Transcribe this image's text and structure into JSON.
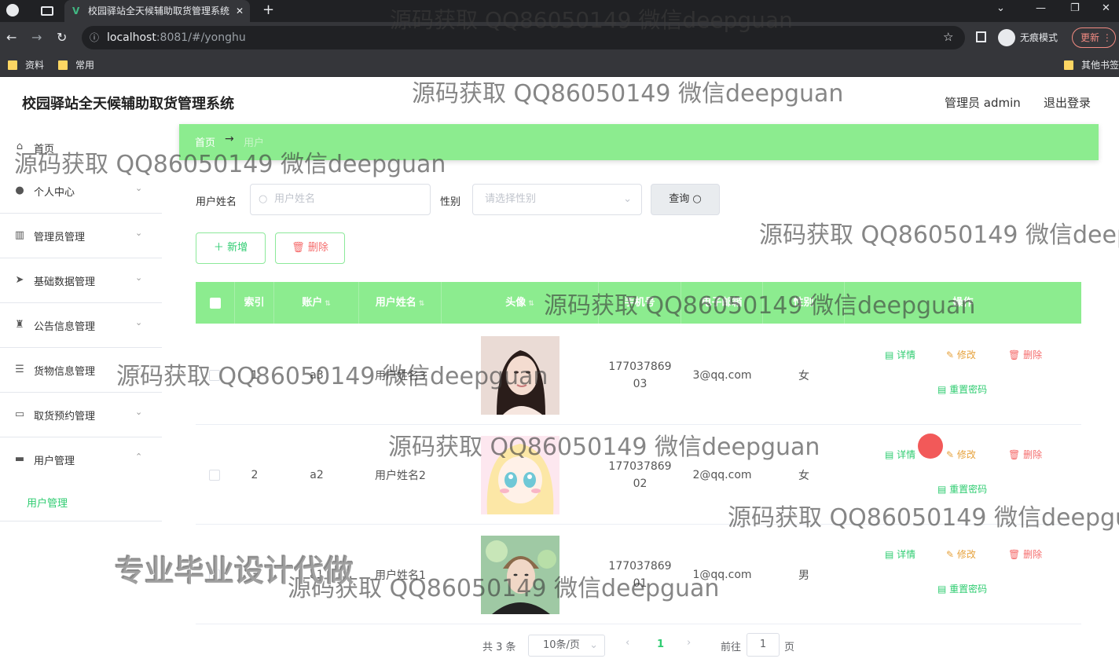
{
  "browser": {
    "tab_title": "校园驿站全天候辅助取货管理系统",
    "url_host": "localhost",
    "url_path": ":8081/#/yonghu",
    "incognito_label": "无痕模式",
    "update_label": "更新",
    "bookmarks": [
      "资料",
      "常用"
    ],
    "other_bookmarks": "其他书签"
  },
  "header": {
    "title": "校园驿站全天候辅助取货管理系统",
    "user": "管理员 admin",
    "logout": "退出登录"
  },
  "sidebar": {
    "items": [
      {
        "label": "首页",
        "icon": "home-icon"
      },
      {
        "label": "个人中心",
        "icon": "person-icon"
      },
      {
        "label": "管理员管理",
        "icon": "chart-icon"
      },
      {
        "label": "基础数据管理",
        "icon": "send-icon"
      },
      {
        "label": "公告信息管理",
        "icon": "trophy-icon"
      },
      {
        "label": "货物信息管理",
        "icon": "sliders-icon"
      },
      {
        "label": "取货预约管理",
        "icon": "message-icon"
      },
      {
        "label": "用户管理",
        "icon": "briefcase-icon"
      }
    ],
    "sub_item": "用户管理"
  },
  "breadcrumb": {
    "home": "首页",
    "sep": "→",
    "current": "用户"
  },
  "search": {
    "name_label": "用户姓名",
    "name_placeholder": "用户姓名",
    "gender_label": "性别",
    "gender_placeholder": "请选择性别",
    "query_button": "查询"
  },
  "actions": {
    "add": "新增",
    "delete": "删除"
  },
  "table": {
    "headers": [
      "索引",
      "账户",
      "用户姓名",
      "头像",
      "手机号",
      "电子邮箱",
      "性别",
      "操作"
    ],
    "rows": [
      {
        "index": "1",
        "account": "a3",
        "name": "用户姓名3",
        "phone": "17703786903",
        "email": "3@qq.com",
        "gender": "女"
      },
      {
        "index": "2",
        "account": "a2",
        "name": "用户姓名2",
        "phone": "17703786902",
        "email": "2@qq.com",
        "gender": "女"
      },
      {
        "index": "3",
        "account": "a1",
        "name": "用户姓名1",
        "phone": "17703786901",
        "email": "1@qq.com",
        "gender": "男"
      }
    ],
    "ops": {
      "detail": "详情",
      "edit": "修改",
      "remove": "删除",
      "reset": "重置密码"
    }
  },
  "pagination": {
    "total": "共 3 条",
    "page_size": "10条/页",
    "current_page": "1",
    "goto_label": "前往",
    "goto_value": "1",
    "page_suffix": "页"
  },
  "watermarks": {
    "text": "源码获取 QQ86050149 微信deepguan",
    "text_cut_1": "源码获取 QQ86050149 微信deep",
    "text_cut_2": "源码获取 QQ86050149 微信deepgu",
    "stamp": "专业毕业设计代做"
  },
  "colors": {
    "accent": "#8cec8f",
    "link_green": "#2fcc71",
    "danger": "#f56c6c",
    "warning": "#e6a23c"
  }
}
